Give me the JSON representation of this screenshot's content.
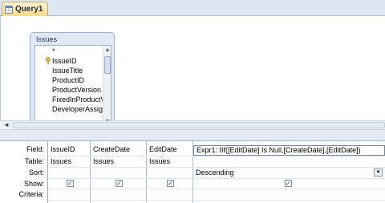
{
  "tab": {
    "label": "Query1",
    "icon": "query-icon"
  },
  "table_window": {
    "title": "Issues",
    "fields": [
      "*",
      "IssueID",
      "IssueTitle",
      "ProductID",
      "ProductVersion",
      "FixedInProductV",
      "DeveloperAssig"
    ],
    "primary_key": "IssueID"
  },
  "grid": {
    "row_labels": [
      "Field:",
      "Table:",
      "Sort:",
      "Show:",
      "Criteria:"
    ],
    "columns": [
      {
        "field": "IssueID",
        "table": "Issues",
        "sort": "",
        "show": true
      },
      {
        "field": "CreateDate",
        "table": "Issues",
        "sort": "",
        "show": true
      },
      {
        "field": "EditDate",
        "table": "Issues",
        "sort": "",
        "show": true
      },
      {
        "field": "Expr1: IIf([EditDate] Is Null,[CreateDate],[EditDate])",
        "table": "",
        "sort": "Descending",
        "show": true
      }
    ]
  },
  "scroll_arrows": {
    "left": "◄",
    "up": "▲",
    "down": "▼",
    "dropdown": "▼"
  },
  "checkmark": "✓",
  "colors": {
    "tab_active": "#f9d98c",
    "panel_bg": "#dfe8f4",
    "border": "#9fb4cf"
  }
}
